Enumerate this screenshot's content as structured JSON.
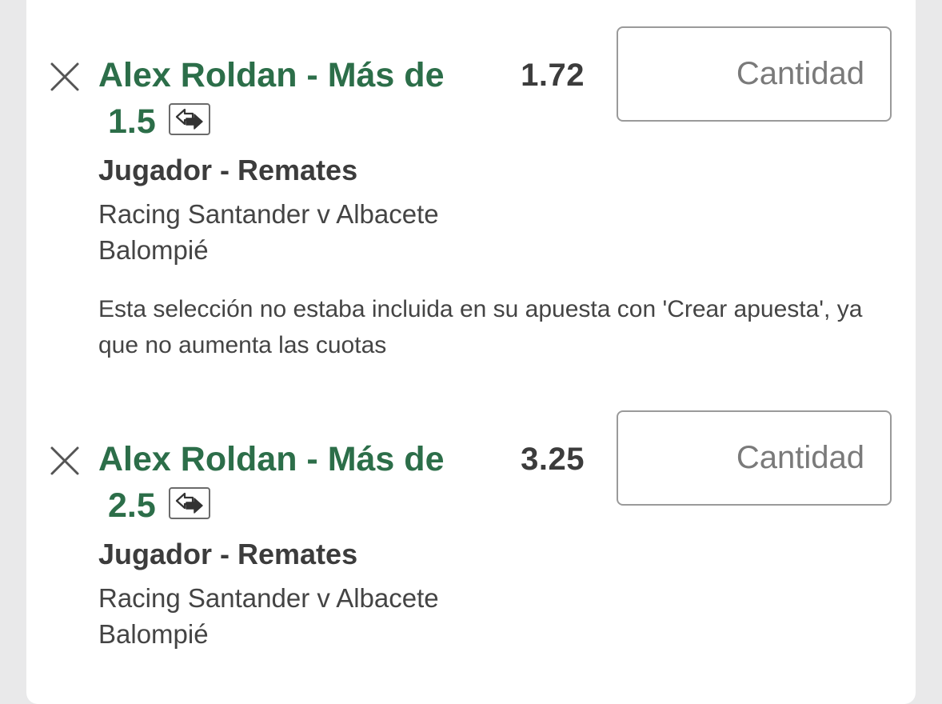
{
  "betslip": {
    "selections": [
      {
        "title_line1": "Alex Roldan - Más de",
        "title_line2": "1.5",
        "odds": "1.72",
        "stake_placeholder": "Cantidad",
        "market": "Jugador - Remates",
        "event_line1": "Racing Santander v Albacete",
        "event_line2": "Balompié",
        "note": "Esta selección no estaba incluida en su apuesta con 'Crear apuesta', ya que no aumenta las cuotas",
        "remove_icon": "close-x-icon",
        "swap_icon": "swap-arrows-icon"
      },
      {
        "title_line1": "Alex Roldan - Más de",
        "title_line2": "2.5",
        "odds": "3.25",
        "stake_placeholder": "Cantidad",
        "market": "Jugador - Remates",
        "event_line1": "Racing Santander v Albacete",
        "event_line2": "Balompié",
        "remove_icon": "close-x-icon",
        "swap_icon": "swap-arrows-icon"
      }
    ]
  },
  "colors": {
    "selection_title": "#2c6e49",
    "text": "#3c3c3c",
    "background": "#e9e9ea",
    "card": "#ffffff"
  }
}
